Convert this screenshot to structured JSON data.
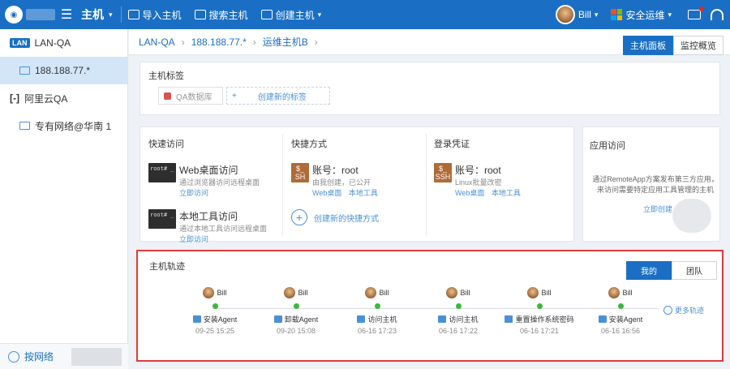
{
  "topbar": {
    "menu_title": "主机",
    "tools": [
      {
        "label": "导入主机"
      },
      {
        "label": "搜索主机"
      },
      {
        "label": "创建主机"
      }
    ],
    "user_name": "Bill",
    "ops_label": "安全运维"
  },
  "sidebar": {
    "items": [
      {
        "label": "LAN-QA",
        "badge": "LAN"
      },
      {
        "label": "188.188.77.*"
      },
      {
        "label": "阿里云QA"
      },
      {
        "label": "专有网络@华南 1"
      }
    ],
    "bottom_label": "按网络"
  },
  "breadcrumb": [
    "LAN-QA",
    "188.188.77.*",
    "运维主机B"
  ],
  "view_tabs": {
    "active": "主机面板",
    "other": "监控概览"
  },
  "tags": {
    "title": "主机标签",
    "chip": "QA数据库",
    "new_label": "创建新的标签"
  },
  "quick_access": {
    "title": "快速访问",
    "items": [
      {
        "name": "Web桌面访问",
        "desc": "通过浏览器访问远程桌面",
        "link": "立即访问",
        "term": "root# _"
      },
      {
        "name": "本地工具访问",
        "desc": "通过本地工具访问远程桌面",
        "link": "立即访问",
        "term": "root# _"
      }
    ]
  },
  "shortcut": {
    "title": "快捷方式",
    "account": "账号：root",
    "desc": "由我创建，已公开",
    "links": [
      "Web桌面",
      "本地工具"
    ],
    "create": "创建新的快捷方式",
    "badge": "SH"
  },
  "credential": {
    "title": "登录凭证",
    "account": "账号：root",
    "desc": "Linux批量改密",
    "links": [
      "Web桌面",
      "本地工具"
    ],
    "badge": "SSH"
  },
  "app_access": {
    "title": "应用访问",
    "desc": "通过RemoteApp方案发布第三方应用，来访问需要特定应用工具管理的主机",
    "link": "立即创建"
  },
  "track": {
    "title": "主机轨迹",
    "tabs": [
      "我的",
      "团队"
    ],
    "events": [
      {
        "user": "Bill",
        "action": "安装Agent",
        "time": "09-25 15:25"
      },
      {
        "user": "Bill",
        "action": "卸载Agent",
        "time": "09-20 15:08"
      },
      {
        "user": "Bill",
        "action": "访问主机",
        "time": "06-16 17:23"
      },
      {
        "user": "Bill",
        "action": "访问主机",
        "time": "06-16 17:22"
      },
      {
        "user": "Bill",
        "action": "重置操作系统密码",
        "time": "06-16 17:21"
      },
      {
        "user": "Bill",
        "action": "安装Agent",
        "time": "06-16 16:56"
      }
    ],
    "more": "更多轨迹"
  }
}
